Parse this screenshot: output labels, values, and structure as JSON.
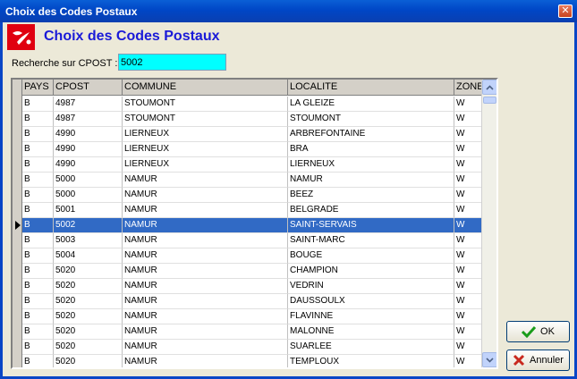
{
  "window": {
    "title": "Choix des Codes Postaux",
    "close_glyph": "✕"
  },
  "header": {
    "title": "Choix des Codes Postaux",
    "logo_icon": "postal-logo-icon"
  },
  "search": {
    "label": "Recherche sur CPOST :",
    "value": "5002"
  },
  "grid": {
    "columns": [
      "PAYS",
      "CPOST",
      "COMMUNE",
      "LOCALITE",
      "ZONE"
    ],
    "selected_index": 8,
    "rows": [
      [
        "B",
        "4987",
        "STOUMONT",
        "LA GLEIZE",
        "W"
      ],
      [
        "B",
        "4987",
        "STOUMONT",
        "STOUMONT",
        "W"
      ],
      [
        "B",
        "4990",
        "LIERNEUX",
        "ARBREFONTAINE",
        "W"
      ],
      [
        "B",
        "4990",
        "LIERNEUX",
        "BRA",
        "W"
      ],
      [
        "B",
        "4990",
        "LIERNEUX",
        "LIERNEUX",
        "W"
      ],
      [
        "B",
        "5000",
        "NAMUR",
        "NAMUR",
        "W"
      ],
      [
        "B",
        "5000",
        "NAMUR",
        "BEEZ",
        "W"
      ],
      [
        "B",
        "5001",
        "NAMUR",
        "BELGRADE",
        "W"
      ],
      [
        "B",
        "5002",
        "NAMUR",
        "SAINT-SERVAIS",
        "W"
      ],
      [
        "B",
        "5003",
        "NAMUR",
        "SAINT-MARC",
        "W"
      ],
      [
        "B",
        "5004",
        "NAMUR",
        "BOUGE",
        "W"
      ],
      [
        "B",
        "5020",
        "NAMUR",
        "CHAMPION",
        "W"
      ],
      [
        "B",
        "5020",
        "NAMUR",
        "VEDRIN",
        "W"
      ],
      [
        "B",
        "5020",
        "NAMUR",
        "DAUSSOULX",
        "W"
      ],
      [
        "B",
        "5020",
        "NAMUR",
        "FLAVINNE",
        "W"
      ],
      [
        "B",
        "5020",
        "NAMUR",
        "MALONNE",
        "W"
      ],
      [
        "B",
        "5020",
        "NAMUR",
        "SUARLEE",
        "W"
      ],
      [
        "B",
        "5020",
        "NAMUR",
        "TEMPLOUX",
        "W"
      ]
    ]
  },
  "buttons": {
    "ok_label": "OK",
    "cancel_label": "Annuler"
  },
  "colors": {
    "accent": "#316ac5",
    "input_bg": "#00ffff",
    "title_blue": "#1a1ad8",
    "logo_red": "#e00010"
  }
}
